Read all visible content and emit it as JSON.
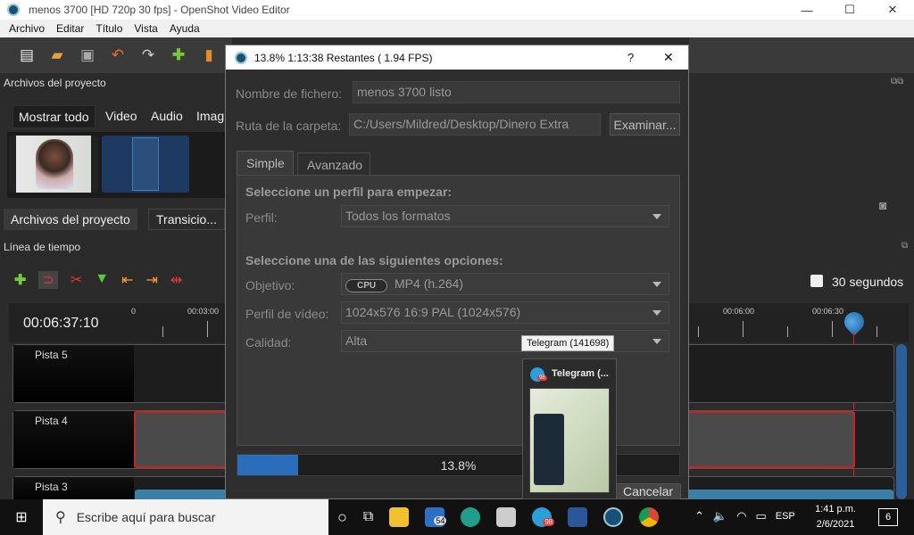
{
  "window": {
    "title": "menos 3700 [HD 720p 30 fps] - OpenShot Video Editor",
    "minimize": "—",
    "maximize": "☐",
    "close": "✕"
  },
  "menu": [
    "Archivo",
    "Editar",
    "Título",
    "Vista",
    "Ayuda"
  ],
  "project_panel": {
    "title": "Archivos del proyecto",
    "filters": [
      "Mostrar todo",
      "Video",
      "Audio",
      "Imag"
    ],
    "tabs": [
      "Archivos del proyecto",
      "Transicio..."
    ]
  },
  "timeline": {
    "title": "Línea de tiempo",
    "timecode": "00:06:37:10",
    "zoom_label": "30 segundos",
    "ruler_left": [
      "0",
      "00:03:00"
    ],
    "ruler_right": [
      "00:06:00",
      "00:06:30"
    ],
    "tracks": [
      "Pista 5",
      "Pista 4",
      "Pista 3"
    ]
  },
  "dialog": {
    "title": "13.8%  1:13:38 Restantes ( 1.94 FPS)",
    "help": "?",
    "close": "✕",
    "filename_label": "Nombre de fichero:",
    "filename_value": "menos 3700 listo",
    "folder_label": "Ruta de la carpeta:",
    "folder_value": "C:/Users/Mildred/Desktop/Dinero Extra",
    "browse": "Examinar...",
    "tabs": [
      "Simple",
      "Avanzado"
    ],
    "profile_heading": "Seleccione un perfil para empezar:",
    "profile_label": "Perfil:",
    "profile_value": "Todos los formatos",
    "options_heading": "Seleccione una de las siguientes opciones:",
    "target_label": "Objetivo:",
    "target_badge": "CPU",
    "target_value": "MP4 (h.264)",
    "video_profile_label": "Perfil de vídeo:",
    "video_profile_value": "1024x576 16:9 PAL (1024x576)",
    "quality_label": "Calidad:",
    "quality_value": "Alta",
    "progress": 0.138,
    "progress_text": "13.8%",
    "cancel": "Cancelar"
  },
  "tooltip": {
    "text": "Telegram (141698)"
  },
  "preview": {
    "title": "Telegram (...",
    "badge": "98"
  },
  "taskbar": {
    "search_placeholder": "Escribe aquí para buscar",
    "mail_badge": "54",
    "telegram_badge": "98",
    "lang": "ESP",
    "time": "1:41 p.m.",
    "date": "2/6/2021",
    "notif_count": "6"
  },
  "colors": {
    "accent": "#2a6ebb",
    "playhead": "#e02020",
    "dialog_bg": "#2e2e2e"
  }
}
